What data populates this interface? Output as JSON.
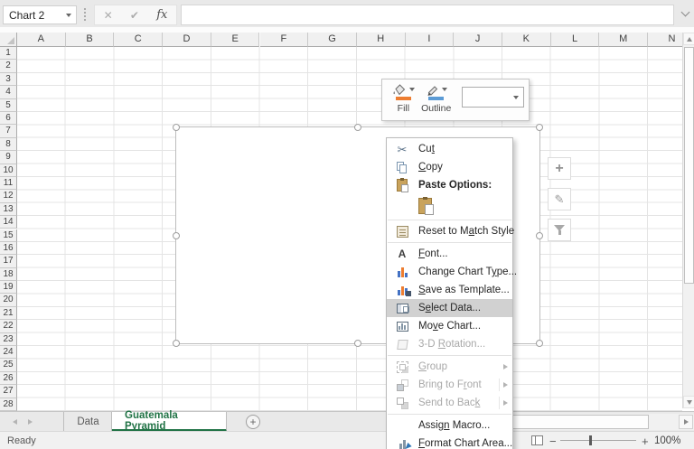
{
  "name_box": {
    "value": "Chart 2"
  },
  "formula_bar": {
    "value": "",
    "fx_label": "fx"
  },
  "grid": {
    "columns": [
      "A",
      "B",
      "C",
      "D",
      "E",
      "F",
      "G",
      "H",
      "I",
      "J",
      "K",
      "L",
      "M",
      "N"
    ],
    "rows": [
      "1",
      "2",
      "3",
      "4",
      "5",
      "6",
      "7",
      "8",
      "9",
      "10",
      "11",
      "12",
      "13",
      "14",
      "15",
      "16",
      "17",
      "18",
      "19",
      "20",
      "21",
      "22",
      "23",
      "24",
      "25",
      "26",
      "27",
      "28"
    ]
  },
  "mini_toolbar": {
    "fill": {
      "label": "Fill",
      "color": "#ED7D31",
      "icon": "paint-bucket-icon"
    },
    "outline": {
      "label": "Outline",
      "color": "#5B9BD5",
      "icon": "pencil-icon"
    }
  },
  "chart_side_buttons": [
    {
      "name": "chart-elements",
      "icon": "plus-icon"
    },
    {
      "name": "chart-styles",
      "icon": "brush-icon"
    },
    {
      "name": "chart-filters",
      "icon": "funnel-icon"
    }
  ],
  "context_menu": {
    "items": [
      {
        "id": "cut",
        "pre": "Cu",
        "key": "t",
        "post": "",
        "icon": "scissors-icon"
      },
      {
        "id": "copy",
        "pre": "",
        "key": "C",
        "post": "opy",
        "icon": "copy-icon"
      },
      {
        "id": "paste-options",
        "pre": "Paste Options:",
        "key": "",
        "post": "",
        "icon": "clipboard-icon",
        "bold": true
      },
      {
        "id": "reset-to-match-style",
        "pre": "Reset to M",
        "key": "a",
        "post": "tch Style",
        "icon": "reset-icon"
      },
      {
        "id": "font",
        "pre": "",
        "key": "F",
        "post": "ont...",
        "icon": "font-a-icon"
      },
      {
        "id": "change-chart-type",
        "pre": "Change Chart T",
        "key": "y",
        "post": "pe...",
        "icon": "bar-chart-icon"
      },
      {
        "id": "save-as-template",
        "pre": "",
        "key": "S",
        "post": "ave as Template...",
        "icon": "chart-save-icon"
      },
      {
        "id": "select-data",
        "pre": "S",
        "key": "e",
        "post": "lect Data...",
        "icon": "select-data-icon",
        "highlighted": true
      },
      {
        "id": "move-chart",
        "pre": "Mo",
        "key": "v",
        "post": "e Chart...",
        "icon": "move-chart-icon"
      },
      {
        "id": "3d-rotation",
        "pre": "3-D ",
        "key": "R",
        "post": "otation...",
        "icon": "cube-icon",
        "disabled": true
      },
      {
        "id": "group",
        "pre": "",
        "key": "G",
        "post": "roup",
        "icon": "group-icon",
        "disabled": true,
        "submenu": true
      },
      {
        "id": "bring-to-front",
        "pre": "Bring to F",
        "key": "r",
        "post": "ont",
        "icon": "bring-front-icon",
        "disabled": true,
        "submenu": true
      },
      {
        "id": "send-to-back",
        "pre": "Send to Bac",
        "key": "k",
        "post": "",
        "icon": "send-back-icon",
        "disabled": true,
        "submenu": true
      },
      {
        "id": "assign-macro",
        "pre": "Assig",
        "key": "n",
        "post": " Macro...",
        "icon": "none"
      },
      {
        "id": "format-chart-area",
        "pre": "",
        "key": "F",
        "post": "ormat Chart Area...",
        "icon": "format-chart-icon"
      }
    ]
  },
  "sheet_tabs": {
    "tabs": [
      {
        "label": "Data",
        "active": false
      },
      {
        "label": "Guatemala Pyramid",
        "active": true
      }
    ],
    "active_color": "#217346"
  },
  "status_bar": {
    "status": "Ready",
    "zoom_level": "100%"
  }
}
